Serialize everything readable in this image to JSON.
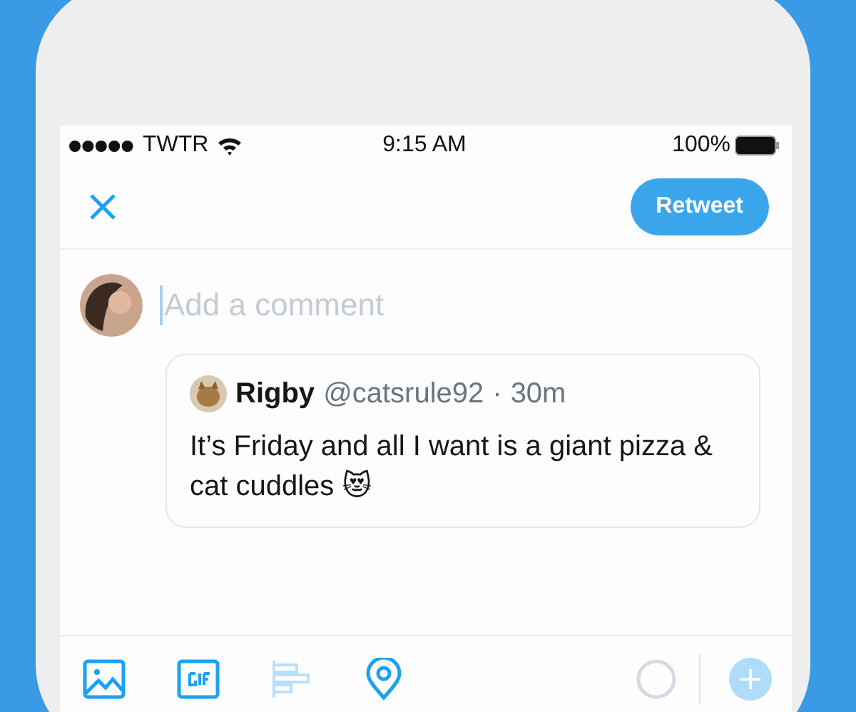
{
  "status_bar": {
    "carrier": "TWTR",
    "time": "9:15 AM",
    "battery": "100%"
  },
  "nav": {
    "retweet_button": "Retweet"
  },
  "compose": {
    "placeholder": "Add a comment"
  },
  "quoted_tweet": {
    "name": "Rigby",
    "handle": "@catsrule92",
    "separator": "·",
    "time": "30m",
    "text": "It’s Friday and all I want is a giant pizza & cat cuddles 😻"
  },
  "toolbar": {
    "items": [
      {
        "kind": "image",
        "disabled": false
      },
      {
        "kind": "gif",
        "disabled": false
      },
      {
        "kind": "poll",
        "disabled": true
      },
      {
        "kind": "location",
        "disabled": false
      }
    ],
    "add_disabled": true
  }
}
